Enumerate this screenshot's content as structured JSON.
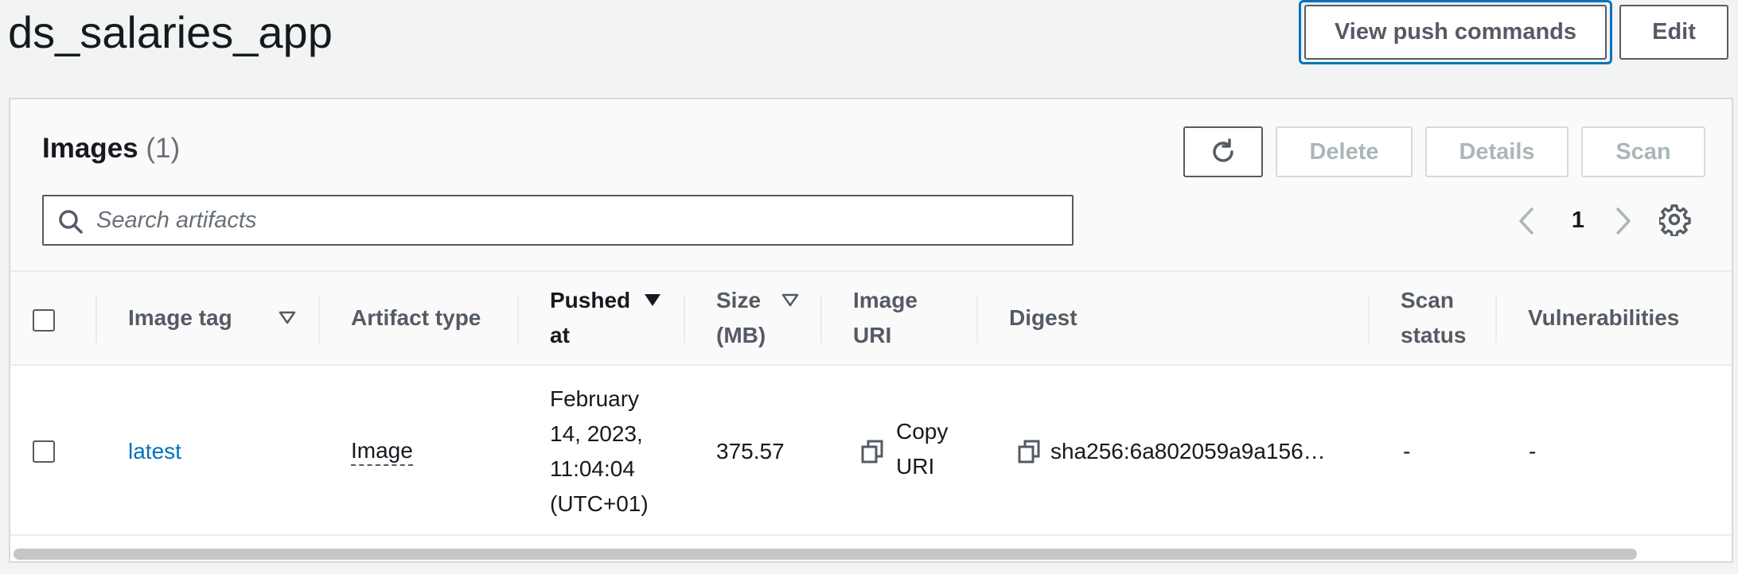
{
  "header": {
    "title": "ds_salaries_app",
    "view_push_commands": "View push commands",
    "edit": "Edit"
  },
  "images_panel": {
    "heading": "Images",
    "count": "(1)",
    "delete": "Delete",
    "details": "Details",
    "scan": "Scan",
    "search_placeholder": "Search artifacts",
    "search_value": "",
    "page": "1"
  },
  "table": {
    "columns": {
      "image_tag": "Image tag",
      "artifact_type": "Artifact type",
      "pushed_at_1": "Pushed",
      "pushed_at_2": "at",
      "size_1": "Size",
      "size_2": "(MB)",
      "image_uri_1": "Image",
      "image_uri_2": "URI",
      "digest": "Digest",
      "scan_status_1": "Scan",
      "scan_status_2": "status",
      "vulnerabilities": "Vulnerabilities"
    },
    "rows": [
      {
        "tag": "latest",
        "artifact_type": "Image",
        "pushed_at_lines": [
          "February",
          "14, 2023,",
          "11:04:04",
          "(UTC+01)"
        ],
        "size": "375.57",
        "copy_uri_1": "Copy",
        "copy_uri_2": "URI",
        "digest": "sha256:6a802059a9a156…",
        "scan_status": "-",
        "vulnerabilities": "-"
      }
    ]
  },
  "icons": {
    "refresh": "refresh-icon",
    "search": "search-icon",
    "prev": "chevron-left-icon",
    "next": "chevron-right-icon",
    "settings": "gear-icon",
    "sort": "sort-caret-icon",
    "copy": "copy-icon"
  },
  "colors": {
    "link": "#0073bb",
    "focus_ring": "#0073bb",
    "disabled_text": "#aab7b8",
    "header_text": "#545b64"
  }
}
